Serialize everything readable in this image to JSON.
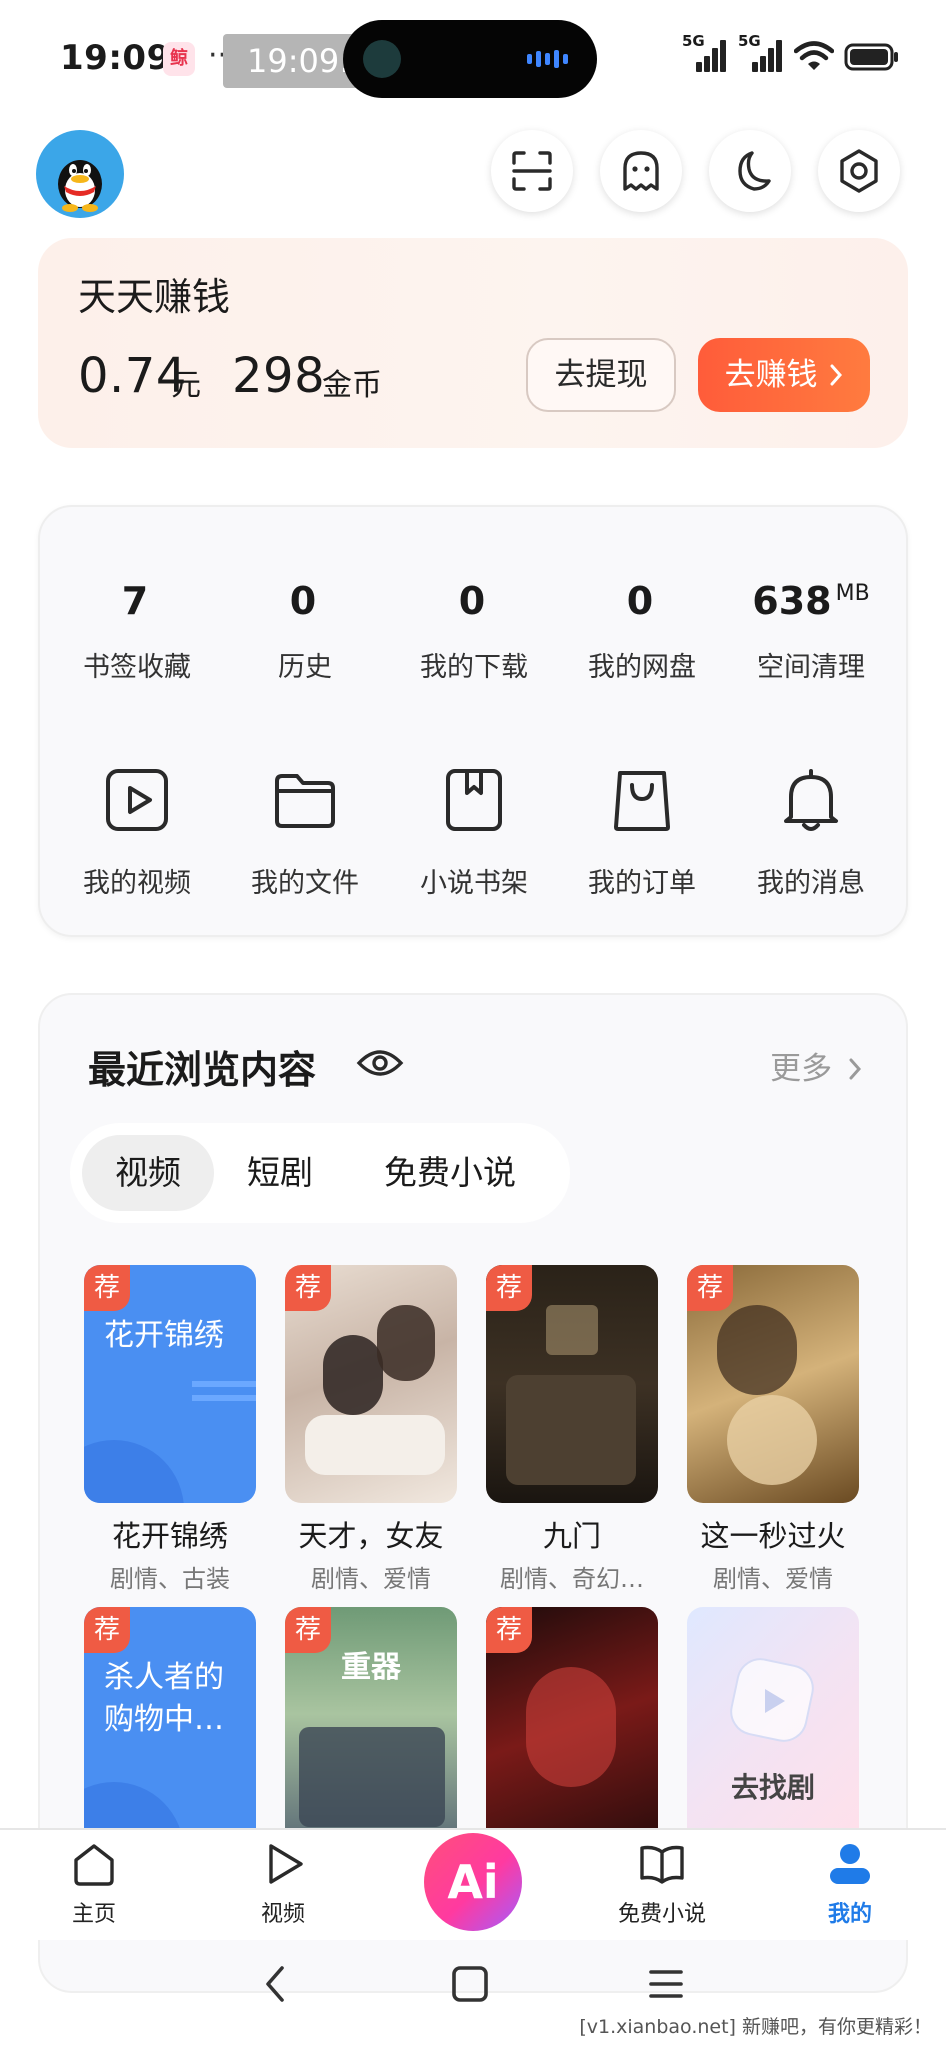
{
  "status_bar": {
    "time": "19:09",
    "app_icon_text": "鲸",
    "dots": "···",
    "clock_pill": "19:09:59",
    "network1": "5G",
    "network2": "5G"
  },
  "earnings": {
    "title": "天天赚钱",
    "cash_value": "0.74",
    "cash_unit": "元",
    "coins_value": "298",
    "coins_unit": "金币",
    "withdraw_label": "去提现",
    "earn_label": "去赚钱"
  },
  "stats": [
    {
      "value": "7",
      "unit": "",
      "label": "书签收藏"
    },
    {
      "value": "0",
      "unit": "",
      "label": "历史"
    },
    {
      "value": "0",
      "unit": "",
      "label": "我的下载"
    },
    {
      "value": "0",
      "unit": "",
      "label": "我的网盘"
    },
    {
      "value": "638",
      "unit": "MB",
      "label": "空间清理"
    }
  ],
  "tools": [
    {
      "label": "我的视频",
      "icon": "play-box-icon"
    },
    {
      "label": "我的文件",
      "icon": "folder-icon"
    },
    {
      "label": "小说书架",
      "icon": "bookmark-book-icon"
    },
    {
      "label": "我的订单",
      "icon": "shopping-bag-icon"
    },
    {
      "label": "我的消息",
      "icon": "bell-icon"
    }
  ],
  "recent": {
    "title": "最近浏览内容",
    "more_label": "更多",
    "tabs": [
      "视频",
      "短剧",
      "免费小说"
    ],
    "active_tab": "视频",
    "badge": "荐",
    "items": [
      {
        "title": "花开锦绣",
        "sub": "剧情、古装",
        "poster_text": "花开锦绣"
      },
      {
        "title": "天才，女友",
        "sub": "剧情、爱情",
        "poster_text": ""
      },
      {
        "title": "九门",
        "sub": "剧情、奇幻…",
        "poster_text": ""
      },
      {
        "title": "这一秒过火",
        "sub": "剧情、爱情",
        "poster_text": ""
      },
      {
        "title": "",
        "sub": "",
        "poster_text": "杀人者的购物中…"
      },
      {
        "title": "",
        "sub": "",
        "poster_text": "重器"
      },
      {
        "title": "",
        "sub": "",
        "poster_text": ""
      },
      {
        "title": "",
        "sub": "",
        "poster_text": "去找剧"
      }
    ]
  },
  "bottom_nav": {
    "home": "主页",
    "video": "视频",
    "ai": "Ai",
    "novel": "免费小说",
    "mine": "我的"
  },
  "watermark": "[v1.xianbao.net] 新赚吧，有你更精彩！",
  "colors": {
    "accent_blue": "#1f7be8",
    "earn_orange": "#ff5c3a",
    "badge_red": "#ef5b44"
  }
}
